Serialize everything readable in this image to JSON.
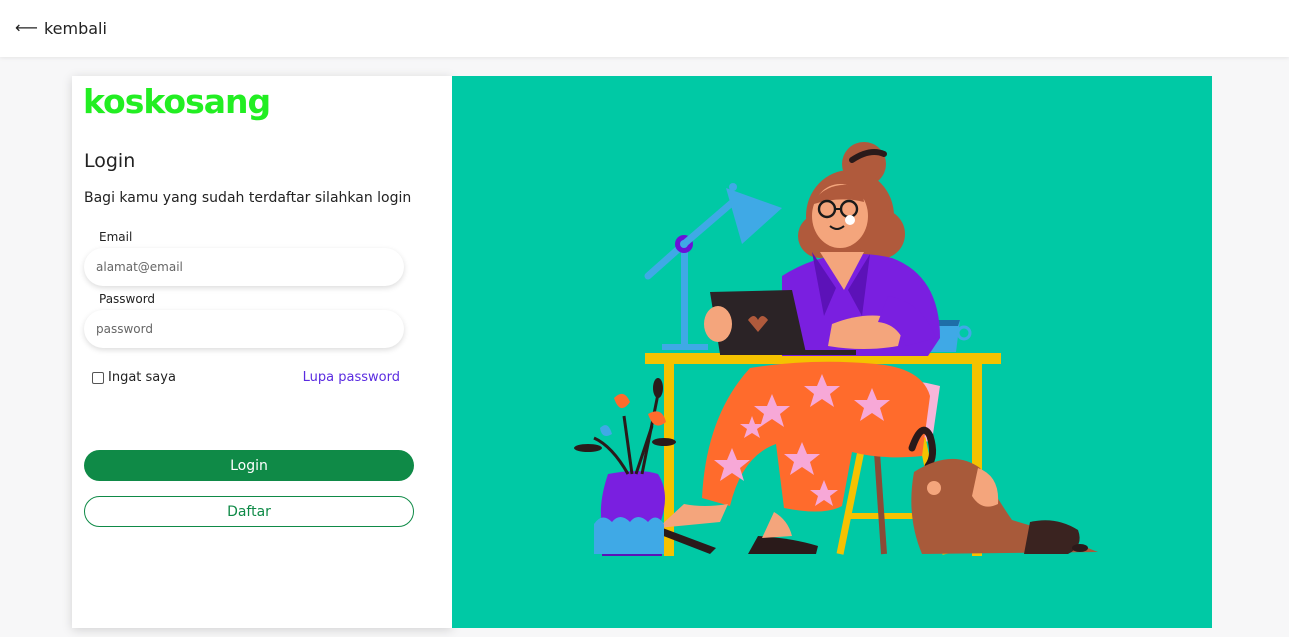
{
  "header": {
    "back_label": "kembali"
  },
  "brand": {
    "logo_text": "koskosang"
  },
  "login": {
    "title": "Login",
    "subtitle": "Bagi kamu yang sudah terdaftar silahkan login",
    "email_label": "Email",
    "email_placeholder": "alamat@email",
    "password_label": "Password",
    "password_placeholder": "password",
    "remember_label": "Ingat saya",
    "forgot_label": "Lupa password",
    "login_button": "Login",
    "register_button": "Daftar"
  },
  "colors": {
    "accent": "#0f8a47",
    "logo": "#22ee22",
    "link": "#5a2be0",
    "hero_bg": "#00c9a5"
  }
}
